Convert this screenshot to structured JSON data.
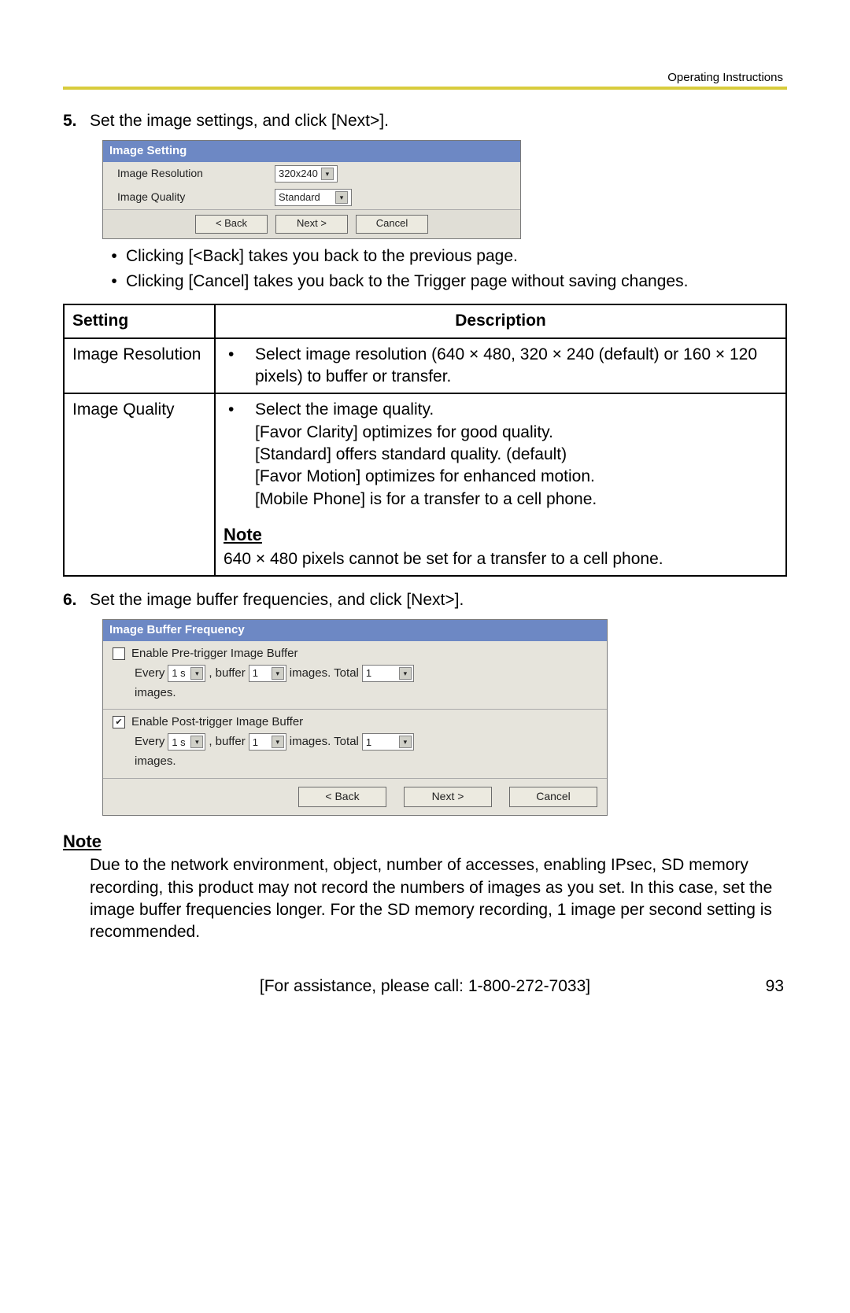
{
  "header": {
    "right": "Operating Instructions"
  },
  "step5": {
    "num": "5.",
    "text": "Set the image settings, and click [Next>].",
    "dialog": {
      "title": "Image Setting",
      "row1_label": "Image Resolution",
      "row1_value": "320x240",
      "row2_label": "Image Quality",
      "row2_value": "Standard",
      "btn_back": "< Back",
      "btn_next": "Next >",
      "btn_cancel": "Cancel"
    },
    "bullets": [
      "Clicking [<Back] takes you back to the previous page.",
      "Clicking [Cancel] takes you back to the Trigger page without saving changes."
    ]
  },
  "table": {
    "head_setting": "Setting",
    "head_desc": "Description",
    "row1_setting": "Image Resolution",
    "row1_desc": "Select image resolution (640 × 480, 320 × 240 (default) or 160 × 120 pixels) to buffer or transfer.",
    "row2_setting": "Image Quality",
    "row2_bullet": "Select the image quality.",
    "row2_l1": "[Favor Clarity] optimizes for good quality.",
    "row2_l2": "[Standard] offers standard quality. (default)",
    "row2_l3": "[Favor Motion] optimizes for enhanced motion.",
    "row2_l4": "[Mobile Phone] is for a transfer to a cell phone.",
    "row2_note_h": "Note",
    "row2_note": "640 × 480 pixels cannot be set for a transfer to a cell phone."
  },
  "step6": {
    "num": "6.",
    "text": "Set the image buffer frequencies, and click [Next>].",
    "dialog": {
      "title": "Image Buffer Frequency",
      "pre_label": "Enable Pre-trigger Image Buffer",
      "post_label": "Enable Post-trigger Image Buffer",
      "t_every": "Every",
      "v_1s": "1 s",
      "t_buffer": ", buffer",
      "v_1": "1",
      "t_images_total": "images. Total",
      "v_total": "1",
      "t_images_end": "images.",
      "btn_back": "< Back",
      "btn_next": "Next >",
      "btn_cancel": "Cancel"
    }
  },
  "note": {
    "h": "Note",
    "body": "Due to the network environment, object, number of accesses, enabling IPsec, SD memory recording, this product may not record the numbers of images as you set. In this case, set the image buffer frequencies longer. For the SD memory recording, 1 image per second setting is recommended."
  },
  "footer": {
    "center": "[For assistance, please call: 1-800-272-7033]",
    "page": "93"
  }
}
